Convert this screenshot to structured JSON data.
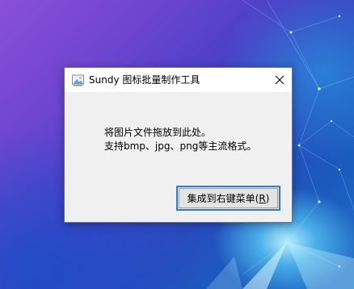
{
  "dialog": {
    "title": "Sundy 图标批量制作工具",
    "close_glyph": "✕",
    "message_line1": "将图片文件拖放到此处。",
    "message_line2": "支持bmp、jpg、png等主流格式。",
    "button_label_prefix": "集成到右键菜单(",
    "button_accel": "R",
    "button_label_suffix": ")"
  },
  "colors": {
    "accent": "#2f7bd8",
    "dialog_bg": "#f0f0f0",
    "titlebar_bg": "#ffffff"
  },
  "icons": {
    "app": "app-icon",
    "close": "close-icon"
  }
}
